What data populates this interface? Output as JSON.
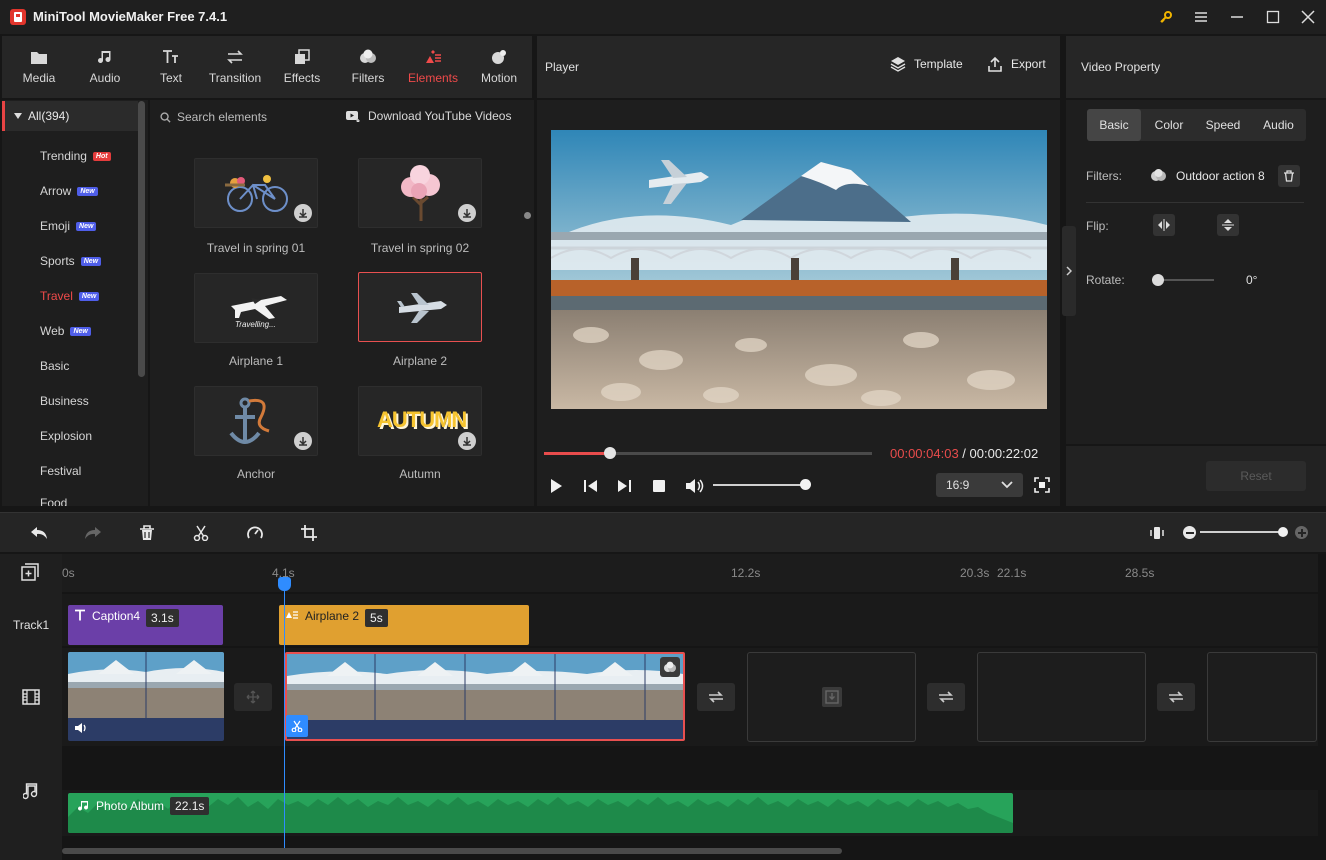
{
  "window": {
    "title": "MiniTool MovieMaker Free 7.4.1"
  },
  "toolbar": {
    "tabs": [
      {
        "label": "Media",
        "icon": "folder-icon"
      },
      {
        "label": "Audio",
        "icon": "music-note-icon"
      },
      {
        "label": "Text",
        "icon": "text-icon"
      },
      {
        "label": "Transition",
        "icon": "transition-icon"
      },
      {
        "label": "Effects",
        "icon": "effects-icon"
      },
      {
        "label": "Filters",
        "icon": "filters-icon"
      },
      {
        "label": "Elements",
        "icon": "elements-icon",
        "active": true
      },
      {
        "label": "Motion",
        "icon": "motion-icon"
      }
    ]
  },
  "categories": {
    "all": "All(394)",
    "items": [
      {
        "label": "Trending",
        "badge": "Hot"
      },
      {
        "label": "Arrow",
        "badge": "New"
      },
      {
        "label": "Emoji",
        "badge": "New"
      },
      {
        "label": "Sports",
        "badge": "New"
      },
      {
        "label": "Travel",
        "badge": "New",
        "active": true
      },
      {
        "label": "Web",
        "badge": "New"
      },
      {
        "label": "Basic",
        "badge": ""
      },
      {
        "label": "Business",
        "badge": ""
      },
      {
        "label": "Explosion",
        "badge": ""
      },
      {
        "label": "Festival",
        "badge": ""
      },
      {
        "label": "Food",
        "badge": ""
      }
    ]
  },
  "elements": {
    "search_placeholder": "Search elements",
    "download_label": "Download YouTube Videos",
    "items": [
      {
        "label": "Travel in spring 01",
        "downloaded": false
      },
      {
        "label": "Travel in spring 02",
        "downloaded": false
      },
      {
        "label": "Airplane 1",
        "downloaded": true,
        "thumb_text": "Travelling..."
      },
      {
        "label": "Airplane 2",
        "downloaded": true,
        "selected": true
      },
      {
        "label": "Anchor",
        "downloaded": false
      },
      {
        "label": "Autumn",
        "downloaded": false,
        "thumb_text": "AUTUMN"
      }
    ]
  },
  "player": {
    "title": "Player",
    "template_label": "Template",
    "export_label": "Export",
    "current_time": "00:00:04:03",
    "total_time": " / 00:00:22:02",
    "progress": 0.2,
    "volume": 1.0,
    "aspect_ratio": "16:9"
  },
  "property": {
    "title": "Video Property",
    "tabs": [
      "Basic",
      "Color",
      "Speed",
      "Audio"
    ],
    "active_tab": "Basic",
    "filters_label": "Filters:",
    "filter_value": "Outdoor action 8",
    "flip_label": "Flip:",
    "rotate_label": "Rotate:",
    "rotate_value": "0°",
    "reset_label": "Reset"
  },
  "timeline": {
    "ruler": [
      "0s",
      "4.1s",
      "12.2s",
      "20.3s",
      "22.1s",
      "28.5s"
    ],
    "track1_label": "Track1",
    "caption_clip": {
      "label": "Caption4",
      "duration": "3.1s"
    },
    "element_clip": {
      "label": "Airplane 2",
      "duration": "5s"
    },
    "audio_clip": {
      "label": "Photo Album",
      "duration": "22.1s"
    }
  },
  "colors": {
    "accent": "#e84c4c",
    "caption_clip": "#6b3fa8",
    "element_clip": "#e0a030",
    "audio_clip": "#27a35a",
    "playhead": "#2f8cff"
  }
}
